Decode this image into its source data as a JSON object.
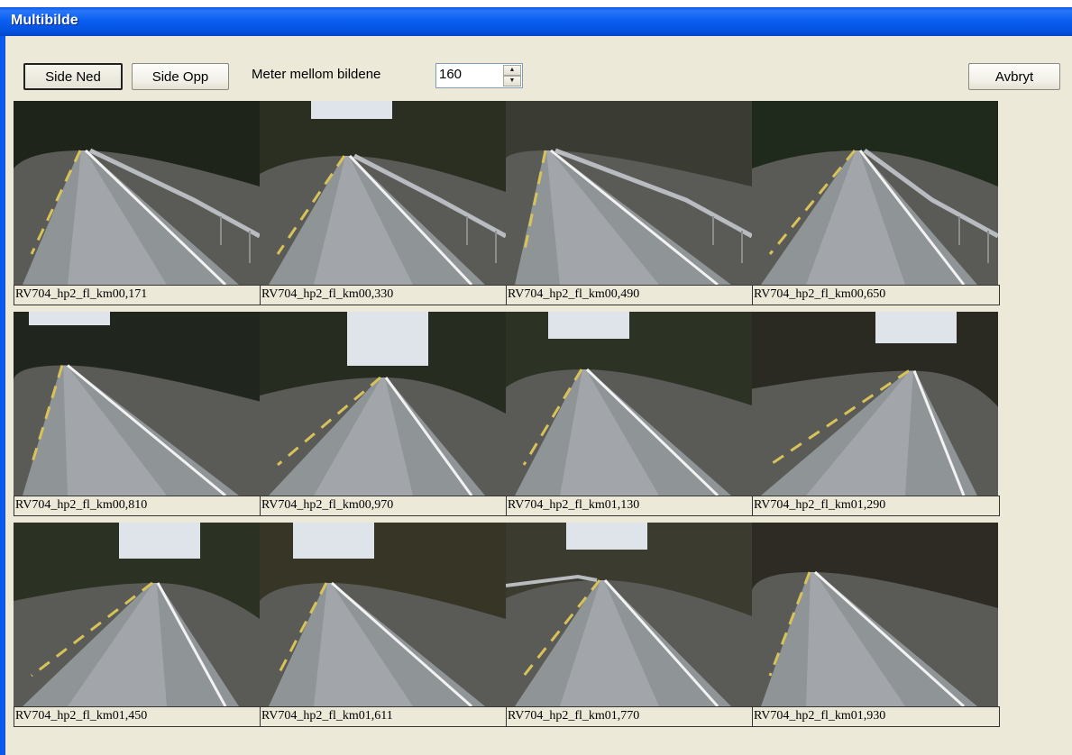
{
  "window": {
    "title": "Multibilde"
  },
  "toolbar": {
    "page_down_label": "Side Ned",
    "page_up_label": "Side Opp",
    "distance_label": "Meter mellom bildene",
    "distance_value": "160",
    "cancel_label": "Avbryt"
  },
  "images": [
    {
      "caption": "RV704_hp2_fl_km00,171"
    },
    {
      "caption": "RV704_hp2_fl_km00,330"
    },
    {
      "caption": "RV704_hp2_fl_km00,490"
    },
    {
      "caption": "RV704_hp2_fl_km00,650"
    },
    {
      "caption": "RV704_hp2_fl_km00,810"
    },
    {
      "caption": "RV704_hp2_fl_km00,970"
    },
    {
      "caption": "RV704_hp2_fl_km01,130"
    },
    {
      "caption": "RV704_hp2_fl_km01,290"
    },
    {
      "caption": "RV704_hp2_fl_km01,450"
    },
    {
      "caption": "RV704_hp2_fl_km01,611"
    },
    {
      "caption": "RV704_hp2_fl_km01,770"
    },
    {
      "caption": "RV704_hp2_fl_km01,930"
    }
  ]
}
